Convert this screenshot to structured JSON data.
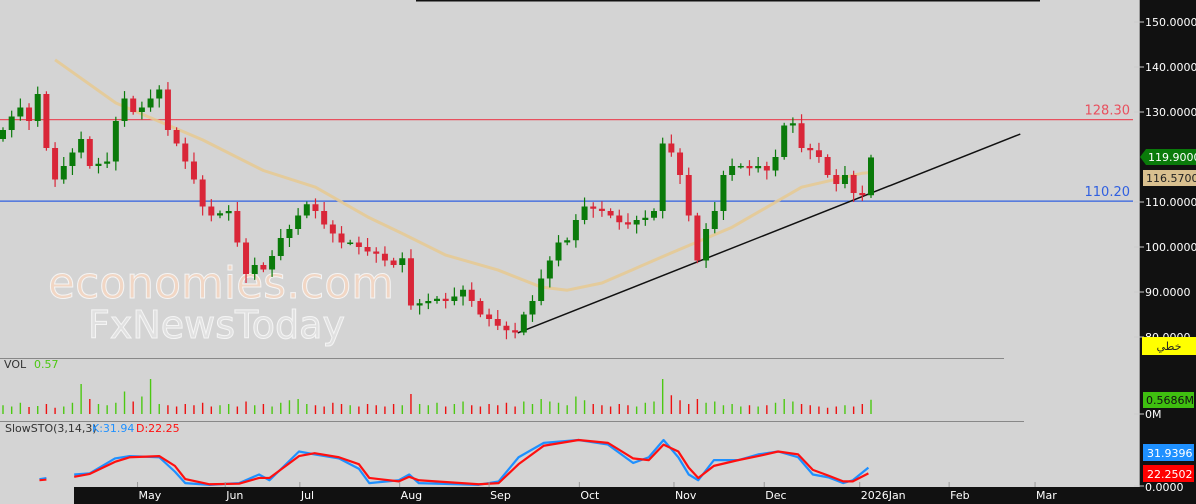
{
  "chart_data": {
    "type": "candlestick",
    "title": "",
    "price_axis": {
      "ticks": [
        "150.0000",
        "140.0000",
        "130.0000",
        "110.0000",
        "100.0000",
        "90.0000",
        "80.0000"
      ],
      "tick_values": [
        150,
        140,
        130,
        110,
        100,
        90,
        80
      ],
      "range": [
        79,
        152
      ]
    },
    "time_axis": {
      "labels": [
        "May",
        "Jun",
        "Jul",
        "Aug",
        "Sep",
        "Oct",
        "Nov",
        "Dec",
        "2026Jan",
        "Feb",
        "Mar"
      ],
      "label_index": [
        15.5,
        25.6,
        34.2,
        45.7,
        56,
        66.4,
        77.3,
        87.7,
        98.7,
        109,
        118.9
      ]
    },
    "closes": [
      126,
      129,
      131,
      128,
      134,
      122,
      115,
      118,
      121,
      124,
      118,
      118.5,
      119,
      128,
      133,
      130,
      131,
      133,
      135,
      126,
      123,
      119,
      115,
      109,
      107,
      107.5,
      108,
      101,
      94,
      96,
      95,
      98,
      102,
      104,
      107,
      109.5,
      108,
      105,
      103,
      101,
      101,
      100,
      99,
      98.5,
      97,
      96,
      97.5,
      87,
      87.5,
      88,
      88.5,
      88,
      89,
      90.5,
      88,
      85,
      84,
      82.5,
      81.5,
      81,
      85,
      88,
      93,
      97,
      101,
      101.5,
      106,
      109,
      108.5,
      108,
      107,
      105.5,
      105,
      106,
      106.5,
      108,
      123,
      121,
      116,
      107,
      97,
      104,
      108,
      116,
      118,
      118,
      117.5,
      118,
      117,
      120,
      127,
      127.5,
      122,
      121.5,
      120,
      116,
      114,
      116,
      112,
      111.5,
      119.9
    ],
    "first_open": 124,
    "moving_average": [
      [
        6,
        141.6
      ],
      [
        13,
        132
      ],
      [
        23,
        123.8
      ],
      [
        30,
        117
      ],
      [
        36,
        113.3
      ],
      [
        42,
        106.7
      ],
      [
        46,
        103
      ],
      [
        51,
        98.2
      ],
      [
        57,
        94.9
      ],
      [
        62,
        91.1
      ],
      [
        65,
        90.4
      ],
      [
        69,
        92
      ],
      [
        77,
        98.7
      ],
      [
        84,
        104.4
      ],
      [
        92,
        113.3
      ],
      [
        99,
        116.4
      ],
      [
        100,
        116.57
      ]
    ],
    "horizontal_lines": [
      {
        "value": 128.3,
        "label": "128.30",
        "color": "#e8505e"
      },
      {
        "value": 110.2,
        "label": "110.20",
        "color": "#3060e0"
      }
    ],
    "trendline": {
      "from": [
        59.3,
        80.9
      ],
      "to": [
        117.2,
        125.1
      ],
      "color": "#111111"
    },
    "last_price": {
      "label": "119.9000",
      "color": "#0a7a0a"
    },
    "ma_price": {
      "label": "116.5700",
      "color": "#d9c08f"
    },
    "line_tag": {
      "label": "خطي",
      "color": "#ffff00"
    },
    "volume": {
      "title": "VOL",
      "value_label": "0.57",
      "last_label": "0.5686M",
      "zero_label": "0M",
      "values": [
        0.35,
        0.3,
        0.45,
        0.28,
        0.32,
        0.4,
        0.25,
        0.3,
        0.45,
        1.2,
        0.6,
        0.4,
        0.35,
        0.45,
        0.9,
        0.5,
        0.7,
        1.4,
        0.4,
        0.35,
        0.3,
        0.4,
        0.35,
        0.45,
        0.3,
        0.35,
        0.4,
        0.3,
        0.5,
        0.35,
        0.4,
        0.3,
        0.45,
        0.55,
        0.6,
        0.4,
        0.35,
        0.3,
        0.45,
        0.4,
        0.35,
        0.3,
        0.4,
        0.35,
        0.3,
        0.4,
        0.35,
        0.8,
        0.4,
        0.35,
        0.45,
        0.3,
        0.4,
        0.5,
        0.35,
        0.3,
        0.4,
        0.35,
        0.45,
        0.3,
        0.5,
        0.4,
        0.6,
        0.5,
        0.45,
        0.35,
        0.7,
        0.55,
        0.4,
        0.35,
        0.3,
        0.4,
        0.35,
        0.3,
        0.45,
        0.5,
        1.4,
        0.75,
        0.55,
        0.4,
        0.6,
        0.45,
        0.5,
        0.35,
        0.4,
        0.3,
        0.35,
        0.3,
        0.35,
        0.45,
        0.6,
        0.5,
        0.4,
        0.35,
        0.3,
        0.25,
        0.3,
        0.35,
        0.3,
        0.4,
        0.57
      ],
      "ylim": [
        0,
        1.6
      ]
    },
    "stochastic": {
      "title": "SlowSTO(3,14,3)",
      "k_label": "K:31.94",
      "d_label": "D:22.25",
      "k_last": "31.9396",
      "d_last": "22.2502",
      "zero_label": "0.0000",
      "k": [
        [
          4.2,
          12
        ],
        [
          5,
          14
        ],
        [
          8.2,
          20
        ],
        [
          10,
          22
        ],
        [
          12.9,
          48
        ],
        [
          14.6,
          52
        ],
        [
          18,
          50
        ],
        [
          19.8,
          25
        ],
        [
          21,
          5
        ],
        [
          23.8,
          2
        ],
        [
          27.2,
          5
        ],
        [
          29.5,
          20
        ],
        [
          30.7,
          10
        ],
        [
          34.1,
          60
        ],
        [
          35.9,
          55
        ],
        [
          38.7,
          48
        ],
        [
          41,
          30
        ],
        [
          42.2,
          5
        ],
        [
          45.6,
          10
        ],
        [
          46.8,
          20
        ],
        [
          47.9,
          5
        ],
        [
          54.8,
          2
        ],
        [
          57.1,
          8
        ],
        [
          59.4,
          50
        ],
        [
          62.3,
          75
        ],
        [
          66.3,
          80
        ],
        [
          69.7,
          72
        ],
        [
          72.6,
          40
        ],
        [
          74.4,
          50
        ],
        [
          76.1,
          80
        ],
        [
          77.8,
          50
        ],
        [
          79,
          20
        ],
        [
          80.1,
          10
        ],
        [
          81.9,
          45
        ],
        [
          84.7,
          45
        ],
        [
          87,
          55
        ],
        [
          89.3,
          60
        ],
        [
          91.6,
          50
        ],
        [
          93.3,
          20
        ],
        [
          95.1,
          15
        ],
        [
          96.8,
          5
        ],
        [
          97.9,
          10
        ],
        [
          99.7,
          32
        ]
      ],
      "d": [
        [
          4.2,
          10
        ],
        [
          5,
          11
        ],
        [
          8.2,
          16
        ],
        [
          10,
          21
        ],
        [
          12.9,
          42
        ],
        [
          14.6,
          50
        ],
        [
          18,
          52
        ],
        [
          19.8,
          35
        ],
        [
          21,
          12
        ],
        [
          23.8,
          3
        ],
        [
          27.2,
          4
        ],
        [
          29.5,
          14
        ],
        [
          30.7,
          14
        ],
        [
          34.1,
          52
        ],
        [
          35.9,
          57
        ],
        [
          38.7,
          50
        ],
        [
          41,
          38
        ],
        [
          42.2,
          14
        ],
        [
          45.6,
          8
        ],
        [
          46.8,
          16
        ],
        [
          47.9,
          10
        ],
        [
          54.8,
          3
        ],
        [
          57.1,
          5
        ],
        [
          59.4,
          38
        ],
        [
          62.3,
          70
        ],
        [
          66.3,
          80
        ],
        [
          69.7,
          75
        ],
        [
          72.6,
          48
        ],
        [
          74.4,
          45
        ],
        [
          76.1,
          72
        ],
        [
          77.8,
          60
        ],
        [
          79,
          32
        ],
        [
          80.1,
          14
        ],
        [
          81.9,
          35
        ],
        [
          84.7,
          45
        ],
        [
          87,
          52
        ],
        [
          89.3,
          60
        ],
        [
          91.6,
          55
        ],
        [
          93.3,
          28
        ],
        [
          95.1,
          18
        ],
        [
          96.8,
          8
        ],
        [
          97.9,
          8
        ],
        [
          99.7,
          22
        ]
      ],
      "ylim": [
        0,
        100
      ]
    },
    "watermark": {
      "line1": "economies.com",
      "line2": "FxNewsToday"
    },
    "colors": {
      "up": "#0a7a0a",
      "down": "#d92638",
      "ma": "#e6c990",
      "k": "#1e90ff",
      "d": "#ff1010",
      "vol_up": "#4cc812",
      "vol_down": "#ee1010"
    }
  }
}
